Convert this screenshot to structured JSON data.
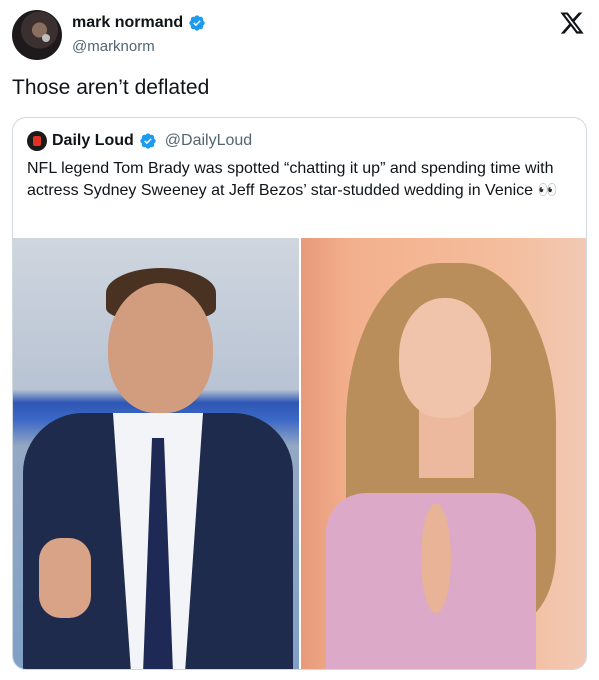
{
  "author": {
    "display_name": "mark normand",
    "handle": "@marknorm",
    "verified": true,
    "avatar_icon": "avatar-photo"
  },
  "platform_icon": "x-logo-icon",
  "tweet": {
    "text": "Those aren’t deflated"
  },
  "quoted": {
    "display_name": "Daily Loud",
    "handle": "@DailyLoud",
    "verified": true,
    "text": "NFL legend Tom Brady was spotted “chatting it up” and spending time with actress Sydney Sweeney at Jeff Bezos’ star-studded wedding in Venice 👀",
    "images": [
      "man-in-suit-thumbs-up-photo",
      "woman-in-pink-dress-photo"
    ]
  },
  "colors": {
    "verified_blue": "#1d9bf0",
    "handle_gray": "#536471",
    "border": "#cfd9de"
  }
}
